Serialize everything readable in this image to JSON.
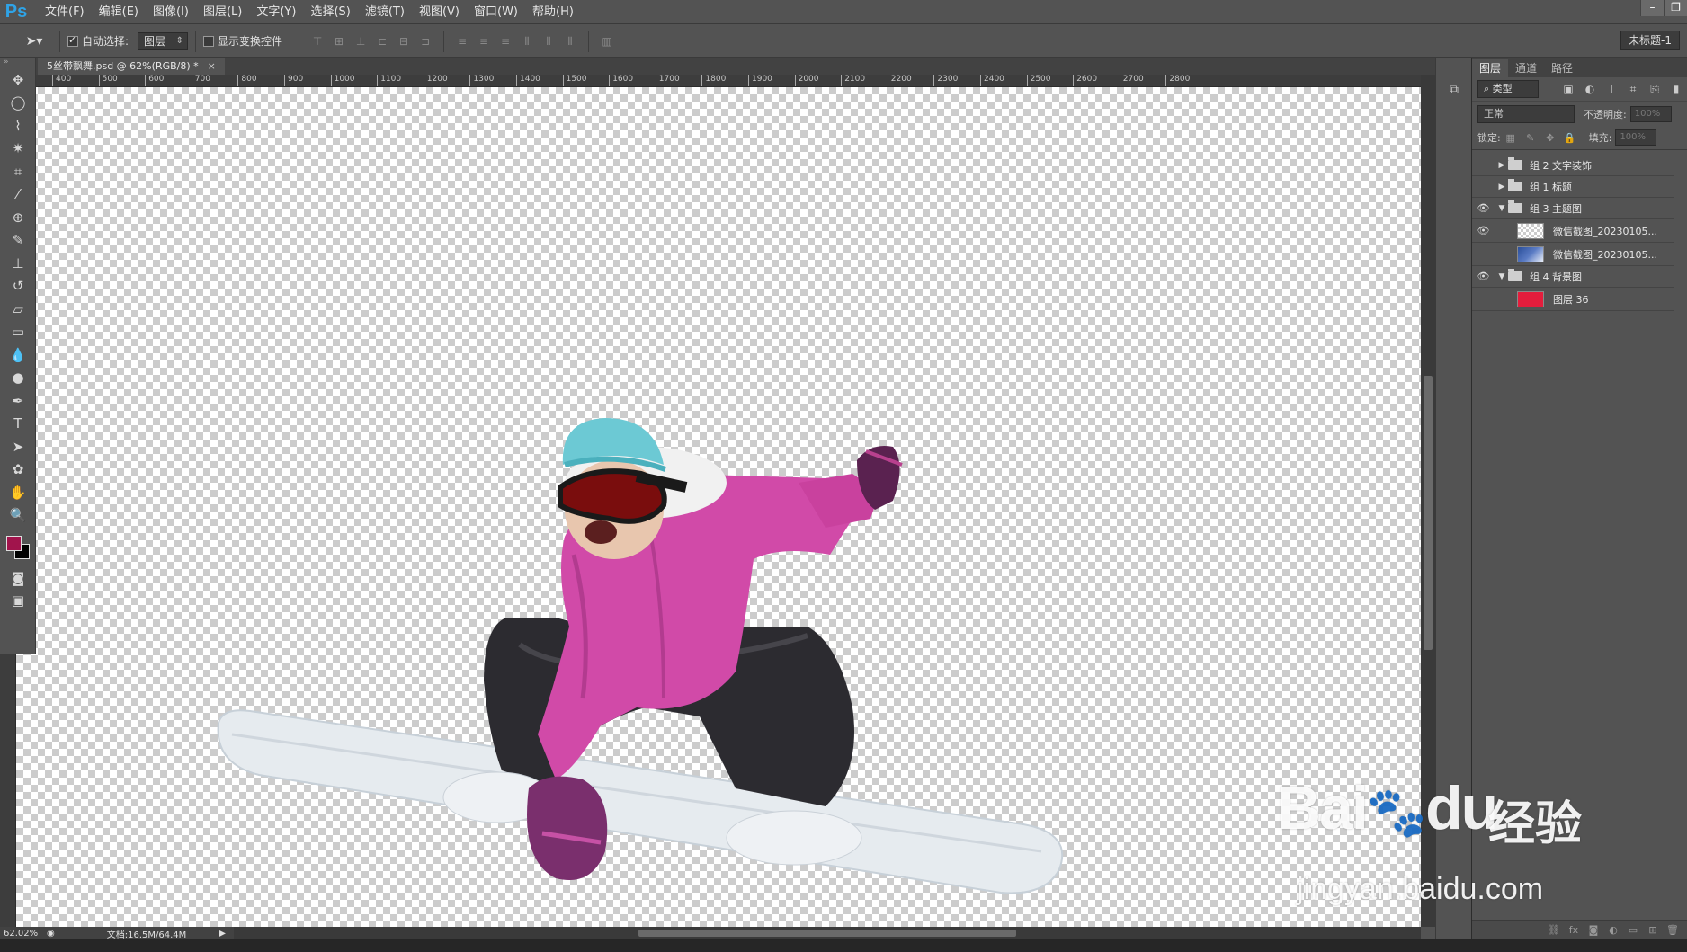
{
  "app": {
    "logo": "Ps",
    "menus": [
      "文件(F)",
      "编辑(E)",
      "图像(I)",
      "图层(L)",
      "文字(Y)",
      "选择(S)",
      "滤镜(T)",
      "视图(V)",
      "窗口(W)",
      "帮助(H)"
    ],
    "window_controls": [
      "minimize",
      "restore"
    ]
  },
  "options_bar": {
    "auto_select_label": "自动选择:",
    "auto_select_checked": true,
    "auto_select_value": "图层",
    "show_transform_label": "显示变换控件",
    "show_transform_checked": false,
    "workspace_label": "未标题-1"
  },
  "document": {
    "tab_title": "5丝带飘舞.psd @ 62%(RGB/8) *",
    "ruler_ticks": [
      "400",
      "500",
      "600",
      "700",
      "800",
      "900",
      "1000",
      "1100",
      "1200",
      "1300",
      "1400",
      "1500",
      "1600",
      "1700",
      "1800",
      "1900",
      "2000",
      "2100",
      "2200",
      "2300",
      "2400",
      "2500",
      "2600",
      "2700",
      "2800"
    ],
    "zoom": "62.02%",
    "doc_size": "文档:16.5M/64.4M"
  },
  "tools": {
    "foreground_color": "#a1144c",
    "background_color": "#000000",
    "icons": [
      "move-tool-icon",
      "marquee-tool-icon",
      "lasso-tool-icon",
      "magic-wand-icon",
      "crop-tool-icon",
      "eyedropper-icon",
      "healing-brush-icon",
      "brush-tool-icon",
      "clone-stamp-icon",
      "history-brush-icon",
      "eraser-tool-icon",
      "gradient-tool-icon",
      "blur-tool-icon",
      "dodge-tool-icon",
      "pen-tool-icon",
      "type-tool-icon",
      "path-selection-icon",
      "shape-tool-icon",
      "hand-tool-icon",
      "zoom-tool-icon"
    ]
  },
  "layers_panel": {
    "tabs": [
      "图层",
      "通道",
      "路径"
    ],
    "kind_filter": "类型",
    "blend_mode": "正常",
    "opacity_label": "不透明度:",
    "opacity_value": "100%",
    "lock_label": "锁定:",
    "fill_label": "填充:",
    "fill_value": "100%",
    "layers": [
      {
        "name": "组 2 文字装饰",
        "type": "group",
        "visible": false,
        "expanded": false
      },
      {
        "name": "组 1 标题",
        "type": "group",
        "visible": false,
        "expanded": false
      },
      {
        "name": "组 3 主题图",
        "type": "group",
        "visible": true,
        "expanded": true
      },
      {
        "name": "微信截图_20230105...",
        "type": "layer",
        "visible": true,
        "thumb": "checker"
      },
      {
        "name": "微信截图_20230105...",
        "type": "layer",
        "visible": false,
        "thumb": "photo"
      },
      {
        "name": "组 4 背景图",
        "type": "group",
        "visible": true,
        "expanded": true
      },
      {
        "name": "图层 36",
        "type": "layer",
        "visible": false,
        "thumb": "red"
      }
    ]
  },
  "watermark": {
    "brand": "Bai",
    "brand_suffix": "du",
    "brand_cn": "经验",
    "url": "jingyan.baidu.com"
  }
}
